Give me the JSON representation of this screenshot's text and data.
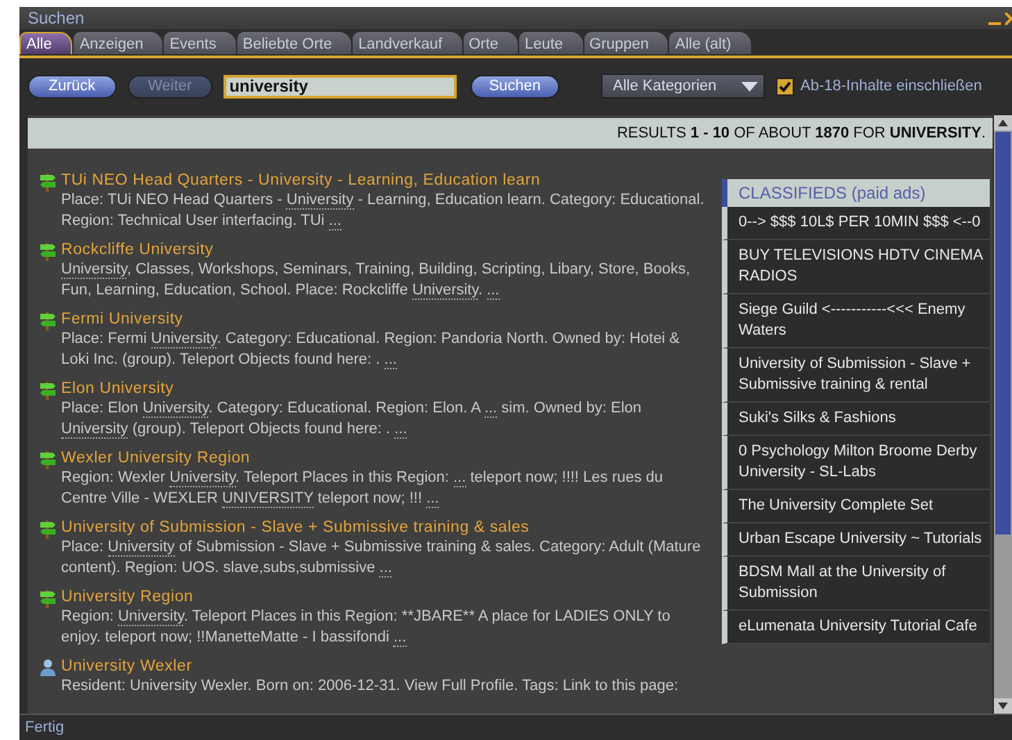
{
  "window": {
    "title": "Suchen"
  },
  "tabs": [
    {
      "label": "Alle",
      "selected": true
    },
    {
      "label": "Anzeigen",
      "selected": false
    },
    {
      "label": "Events",
      "selected": false
    },
    {
      "label": "Beliebte Orte",
      "selected": false
    },
    {
      "label": "Landverkauf",
      "selected": false
    },
    {
      "label": "Orte",
      "selected": false
    },
    {
      "label": "Leute",
      "selected": false
    },
    {
      "label": "Gruppen",
      "selected": false
    },
    {
      "label": "Alle (alt)",
      "selected": false
    }
  ],
  "toolbar": {
    "back": {
      "label": "Zurück",
      "disabled": false
    },
    "forward": {
      "label": "Weiter",
      "disabled": true
    },
    "search_field": {
      "value": "university"
    },
    "search_button": "Suchen",
    "category": "Alle Kategorien",
    "adult": {
      "label": "Ab-18-Inhalte einschließen",
      "checked": true
    }
  },
  "results_header": [
    {
      "text": "RESULTS ",
      "bold": false
    },
    {
      "text": "1 - 10",
      "bold": true
    },
    {
      "text": " OF ABOUT ",
      "bold": false
    },
    {
      "text": "1870",
      "bold": true
    },
    {
      "text": " FOR ",
      "bold": false
    },
    {
      "text": "UNIVERSITY",
      "bold": true
    },
    {
      "text": ".",
      "bold": false
    }
  ],
  "results": [
    {
      "kind": "place",
      "title": "TUi NEO Head Quarters - University - Learning, Education learn",
      "description": [
        {
          "text": "Place: TUi NEO Head Quarters - ",
          "link": false
        },
        {
          "text": "University",
          "link": true
        },
        {
          "text": " - Learning, Education learn. Category: Educational. Region: Technical User interfacing. TUi ",
          "link": false
        },
        {
          "text": "...",
          "link": true
        }
      ]
    },
    {
      "kind": "place",
      "title": "Rockcliffe University",
      "description": [
        {
          "text": "University",
          "link": true
        },
        {
          "text": ", Classes, Workshops, Seminars, Training, Building, Scripting, Libary, Store, Books, Fun, Learning, Education, School. Place: Rockcliffe ",
          "link": false
        },
        {
          "text": "University",
          "link": true
        },
        {
          "text": ". ",
          "link": false
        },
        {
          "text": "...",
          "link": true
        }
      ]
    },
    {
      "kind": "place",
      "title": "Fermi University",
      "description": [
        {
          "text": "Place: Fermi ",
          "link": false
        },
        {
          "text": "University",
          "link": true
        },
        {
          "text": ". Category: Educational. Region: Pandoria North. Owned by: Hotei & Loki Inc. (group). Teleport Objects found here: . ",
          "link": false
        },
        {
          "text": "...",
          "link": true
        }
      ]
    },
    {
      "kind": "place",
      "title": "Elon University",
      "description": [
        {
          "text": "Place: Elon ",
          "link": false
        },
        {
          "text": "University",
          "link": true
        },
        {
          "text": ". Category: Educational. Region: Elon. A ",
          "link": false
        },
        {
          "text": "...",
          "link": true
        },
        {
          "text": " sim. Owned by: Elon ",
          "link": false
        },
        {
          "text": "University",
          "link": true
        },
        {
          "text": " (group). Teleport Objects found here: . ",
          "link": false
        },
        {
          "text": "...",
          "link": true
        }
      ]
    },
    {
      "kind": "place",
      "title": "Wexler University Region",
      "description": [
        {
          "text": "Region: Wexler ",
          "link": false
        },
        {
          "text": "University",
          "link": true
        },
        {
          "text": ". Teleport Places in this Region: ",
          "link": false
        },
        {
          "text": "...",
          "link": true
        },
        {
          "text": " teleport now; !!!! Les rues du Centre Ville - WEXLER ",
          "link": false
        },
        {
          "text": "UNIVERSITY",
          "link": true
        },
        {
          "text": " teleport now; !!! ",
          "link": false
        },
        {
          "text": "...",
          "link": true
        }
      ]
    },
    {
      "kind": "place",
      "title": "University of Submission - Slave + Submissive training & sales",
      "description": [
        {
          "text": "Place: ",
          "link": false
        },
        {
          "text": "University",
          "link": true
        },
        {
          "text": " of Submission - Slave + Submissive training & sales. Category: Adult (Mature content). Region: UOS. slave,subs,submissive ",
          "link": false
        },
        {
          "text": "...",
          "link": true
        }
      ]
    },
    {
      "kind": "place",
      "title": "University Region",
      "description": [
        {
          "text": "Region: ",
          "link": false
        },
        {
          "text": "University",
          "link": true
        },
        {
          "text": ". Teleport Places in this Region: **JBARE** A place for LADIES ONLY to enjoy. teleport now; !!ManetteMatte - I bassifondi ",
          "link": false
        },
        {
          "text": "...",
          "link": true
        }
      ]
    },
    {
      "kind": "person",
      "title": "University Wexler",
      "description": [
        {
          "text": "Resident: University Wexler. Born on: 2006-12-31. View Full Profile. Tags: Link to this page:",
          "link": false
        }
      ]
    }
  ],
  "classifieds": {
    "title": "CLASSIFIEDS (paid ads)",
    "items": [
      "0--> $$$ 10L$ PER 10MIN $$$ <--0",
      "BUY TELEVISIONS HDTV CINEMA RADIOS",
      "Siege Guild <-----------<<< Enemy Waters",
      "University of Submission - Slave + Submissive training & rental",
      "Suki's Silks & Fashions",
      "0 Psychology Milton Broome Derby University - SL-Labs",
      "The University Complete Set",
      "Urban Escape University ~ Tutorials",
      "BDSM Mall at the University of Submission",
      "eLumenata University Tutorial Cafe"
    ]
  },
  "status_bar": "Fertig"
}
